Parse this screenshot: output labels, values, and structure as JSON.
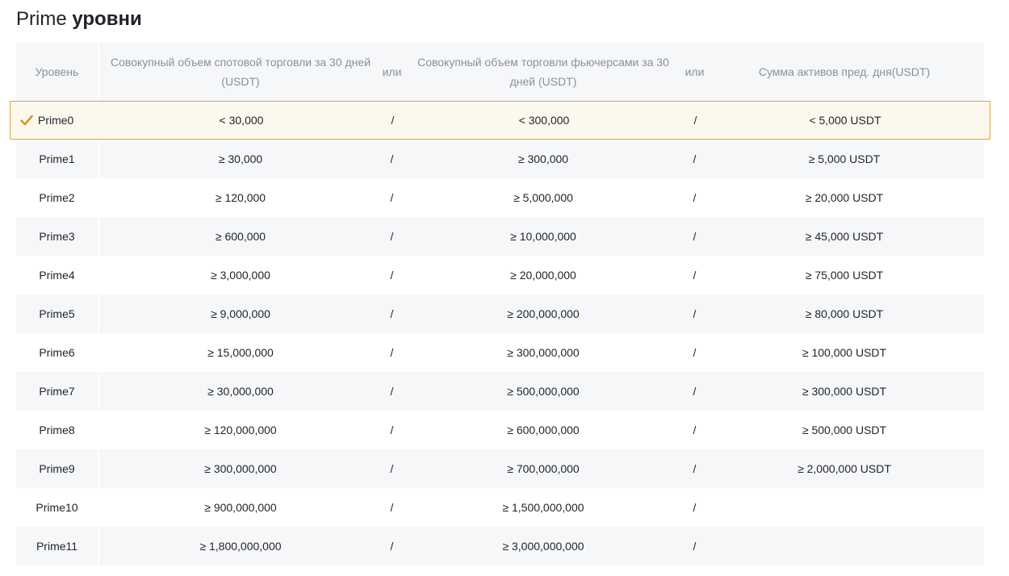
{
  "title": {
    "prefix": "Prime",
    "suffix": "уровни"
  },
  "colors": {
    "accent": "#d9952a",
    "current_border": "#d9a23c",
    "current_bg": "#fdf8ee",
    "alt_row_bg": "#f6f7f8",
    "header_text": "#8a9099"
  },
  "header": {
    "level": "Уровень",
    "spot": "Совокупный объем спотовой торговли за 30 дней (USDT)",
    "or1": "или",
    "futures": "Совокупный объем торговли фьючерсами за 30 дней (USDT)",
    "or2": "или",
    "assets": "Сумма активов пред. дня(USDT)"
  },
  "current_icon": "check-icon",
  "rows": [
    {
      "level": "Prime0",
      "spot": "< 30,000",
      "or1": "/",
      "futures": "< 300,000",
      "or2": "/",
      "assets": "< 5,000 USDT",
      "current": true
    },
    {
      "level": "Prime1",
      "spot": "≥ 30,000",
      "or1": "/",
      "futures": "≥ 300,000",
      "or2": "/",
      "assets": "≥ 5,000 USDT"
    },
    {
      "level": "Prime2",
      "spot": "≥ 120,000",
      "or1": "/",
      "futures": "≥ 5,000,000",
      "or2": "/",
      "assets": "≥ 20,000 USDT"
    },
    {
      "level": "Prime3",
      "spot": "≥ 600,000",
      "or1": "/",
      "futures": "≥ 10,000,000",
      "or2": "/",
      "assets": "≥ 45,000 USDT"
    },
    {
      "level": "Prime4",
      "spot": "≥ 3,000,000",
      "or1": "/",
      "futures": "≥ 20,000,000",
      "or2": "/",
      "assets": "≥ 75,000 USDT"
    },
    {
      "level": "Prime5",
      "spot": "≥ 9,000,000",
      "or1": "/",
      "futures": "≥ 200,000,000",
      "or2": "/",
      "assets": "≥ 80,000 USDT"
    },
    {
      "level": "Prime6",
      "spot": "≥ 15,000,000",
      "or1": "/",
      "futures": "≥ 300,000,000",
      "or2": "/",
      "assets": "≥ 100,000 USDT"
    },
    {
      "level": "Prime7",
      "spot": "≥ 30,000,000",
      "or1": "/",
      "futures": "≥ 500,000,000",
      "or2": "/",
      "assets": "≥ 300,000 USDT"
    },
    {
      "level": "Prime8",
      "spot": "≥ 120,000,000",
      "or1": "/",
      "futures": "≥ 600,000,000",
      "or2": "/",
      "assets": "≥ 500,000 USDT"
    },
    {
      "level": "Prime9",
      "spot": "≥ 300,000,000",
      "or1": "/",
      "futures": "≥ 700,000,000",
      "or2": "/",
      "assets": "≥ 2,000,000 USDT"
    },
    {
      "level": "Prime10",
      "spot": "≥ 900,000,000",
      "or1": "/",
      "futures": "≥ 1,500,000,000",
      "or2": "/",
      "assets": ""
    },
    {
      "level": "Prime11",
      "spot": "≥ 1,800,000,000",
      "or1": "/",
      "futures": "≥ 3,000,000,000",
      "or2": "/",
      "assets": ""
    }
  ]
}
